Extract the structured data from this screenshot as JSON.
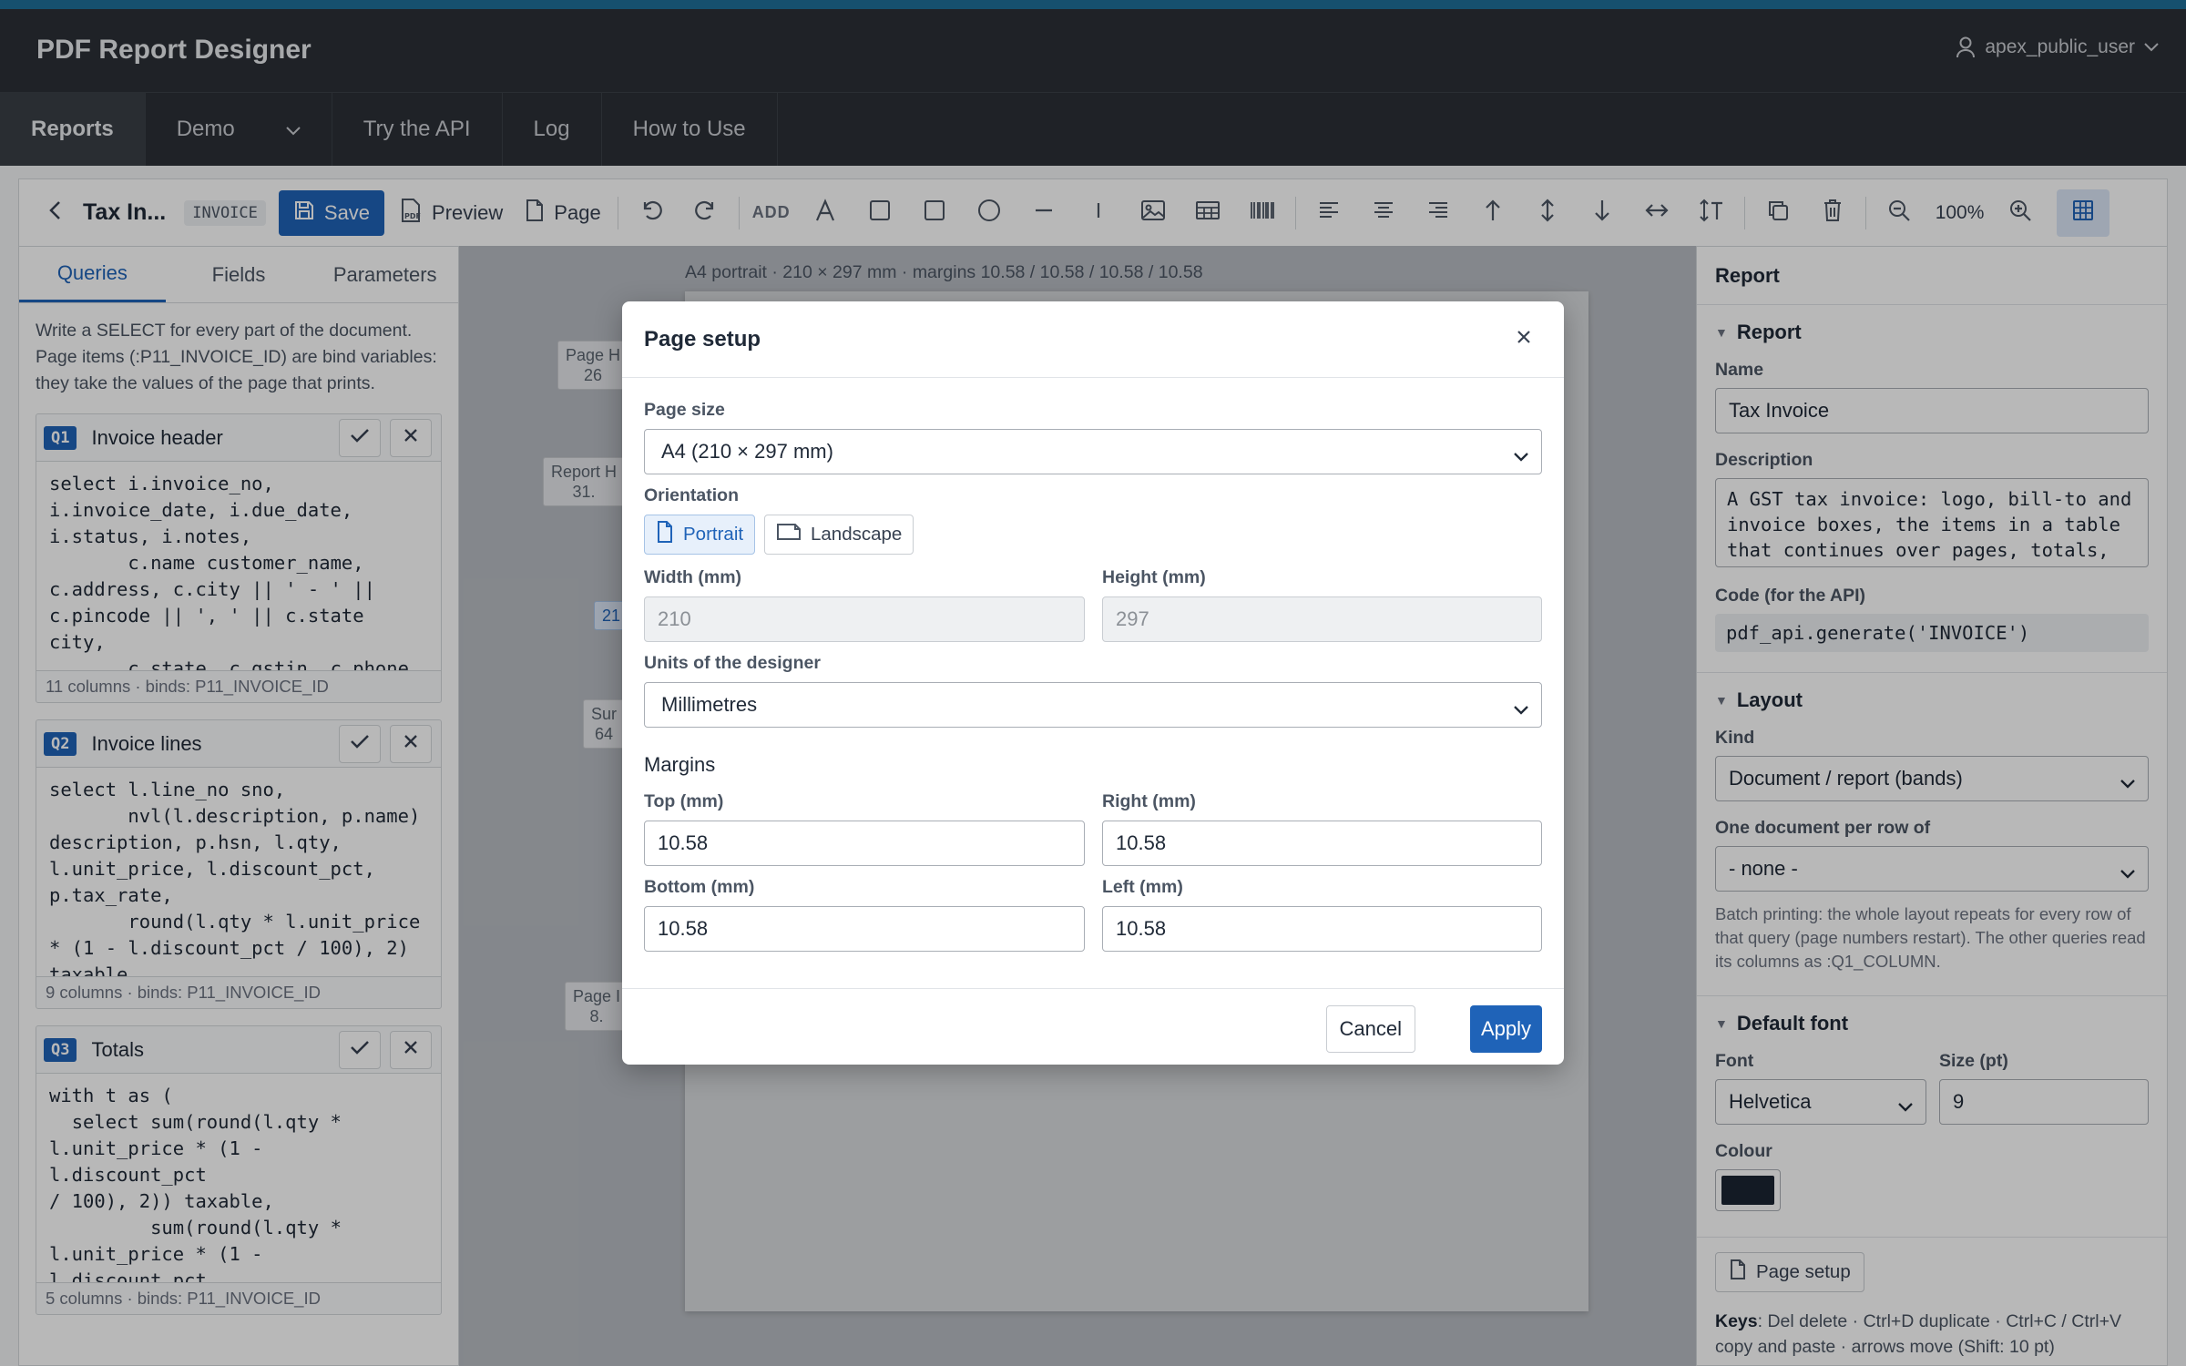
{
  "app": {
    "title": "PDF Report Designer",
    "user": "apex_public_user"
  },
  "nav": [
    {
      "label": "Reports"
    },
    {
      "label": "Demo"
    },
    {
      "label": "Try the API"
    },
    {
      "label": "Log"
    },
    {
      "label": "How to Use"
    }
  ],
  "toolbar": {
    "report_name": "Tax In...",
    "report_code": "INVOICE",
    "save_label": "Save",
    "preview_label": "Preview",
    "page_label": "Page",
    "add_label": "ADD",
    "zoom": "100%"
  },
  "left_panel": {
    "tabs": [
      "Queries",
      "Fields",
      "Parameters"
    ],
    "intro": "Write a SELECT for every part of the document. Page items (:P11_INVOICE_ID) are bind variables: they take the values of the page that prints.",
    "queries": [
      {
        "badge": "Q1",
        "title": "Invoice header",
        "sql": "select i.invoice_no,\ni.invoice_date, i.due_date,\ni.status, i.notes,\n       c.name customer_name,\nc.address, c.city || ' - ' ||\nc.pincode || ', ' || c.state city,\n       c.state, c.gstin, c.phone\n  from pdf_demo_invoices i",
        "footer": "11 columns · binds: P11_INVOICE_ID"
      },
      {
        "badge": "Q2",
        "title": "Invoice lines",
        "sql": "select l.line_no sno,\n       nvl(l.description, p.name)\ndescription, p.hsn, l.qty,\nl.unit_price, l.discount_pct,\np.tax_rate,\n       round(l.qty * l.unit_price\n* (1 - l.discount_pct / 100), 2)\ntaxable",
        "footer": "9 columns · binds: P11_INVOICE_ID"
      },
      {
        "badge": "Q3",
        "title": "Totals",
        "sql": "with t as (\n  select sum(round(l.qty *\nl.unit_price * (1 - l.discount_pct\n/ 100), 2)) taxable,\n         sum(round(l.qty *\nl.unit_price * (1 - l.discount_pct\n/ 100) * p.tax_rate / 100, 2)) tax\n    from pdf_demo_invoice_lines l",
        "footer": "5 columns · binds: P11_INVOICE_ID"
      }
    ]
  },
  "canvas": {
    "info": "A4 portrait · 210 × 297 mm · margins 10.58 / 10.58 / 10.58 / 10.58",
    "bands": [
      {
        "label": "Page H",
        "sub": "26"
      },
      {
        "label": "Report H",
        "sub": "31."
      },
      {
        "label": "",
        "sub": "21"
      },
      {
        "label": "Sur",
        "sub": "64"
      },
      {
        "label": "Page I",
        "sub": "8."
      }
    ]
  },
  "modal": {
    "title": "Page setup",
    "page_size_label": "Page size",
    "page_size_value": "A4 (210 × 297 mm)",
    "orientation_label": "Orientation",
    "orientation_portrait": "Portrait",
    "orientation_landscape": "Landscape",
    "width_label": "Width (mm)",
    "width_value": "210",
    "height_label": "Height (mm)",
    "height_value": "297",
    "units_label": "Units of the designer",
    "units_value": "Millimetres",
    "margins_title": "Margins",
    "top_label": "Top (mm)",
    "top_value": "10.58",
    "right_label": "Right (mm)",
    "right_value": "10.58",
    "bottom_label": "Bottom (mm)",
    "bottom_value": "10.58",
    "left_label": "Left (mm)",
    "left_value": "10.58",
    "cancel_label": "Cancel",
    "apply_label": "Apply"
  },
  "right_panel": {
    "header": "Report",
    "report_section": "Report",
    "name_label": "Name",
    "name_value": "Tax Invoice",
    "description_label": "Description",
    "description_value": "A GST tax invoice: logo, bill-to and invoice boxes, the items in a table that continues over pages, totals, amount in words, PAID stamp",
    "code_label": "Code (for the API)",
    "code_value": "pdf_api.generate('INVOICE')",
    "layout_section": "Layout",
    "kind_label": "Kind",
    "kind_value": "Document / report (bands)",
    "per_row_label": "One document per row of",
    "per_row_value": "- none -",
    "per_row_help": "Batch printing: the whole layout repeats for every row of that query (page numbers restart). The other queries read its columns as :Q1_COLUMN.",
    "font_section": "Default font",
    "font_label": "Font",
    "font_value": "Helvetica",
    "size_label": "Size (pt)",
    "size_value": "9",
    "colour_label": "Colour",
    "colour_value": "#1b2433",
    "page_setup_button": "Page setup",
    "keys_label": "Keys",
    "keys_text": ": Del delete · Ctrl+D duplicate · Ctrl+C / Ctrl+V copy and paste · arrows move (Shift: 10 pt)"
  },
  "colors": {
    "accent": "#1f6f99",
    "primary": "#1f63b8",
    "appbar": "#2c3036"
  }
}
